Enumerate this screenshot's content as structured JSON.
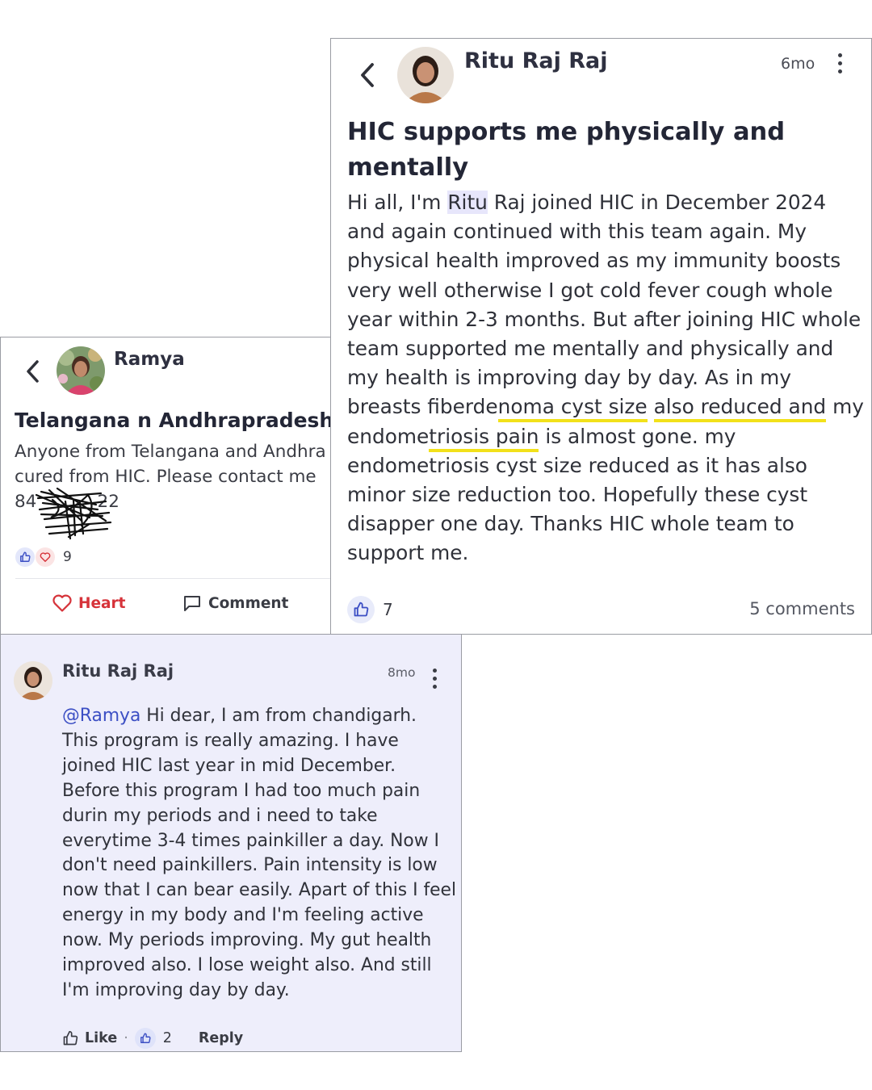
{
  "ramya_post": {
    "author": "Ramya",
    "title": "Telangana n Andhrapradesh",
    "body_lines": [
      "Anyone from Telangana and Andhra",
      "cured from HIC. Please contact me",
      "84           22"
    ],
    "reaction_count": "9",
    "heart_label": "Heart",
    "comment_label": "Comment"
  },
  "ritu_post": {
    "author": "Ritu Raj Raj",
    "time": "6mo",
    "title": "HIC supports me physically and mentally",
    "body": {
      "p1": "Hi all, I'm ",
      "highlight": "Ritu",
      "p2": " Raj joined HIC in December 2024 and again continued with this team again. My physical health improved as my immunity boosts very well otherwise I got cold fever cough whole year within 2-3 months. But after joining HIC whole team supported me mentally and physically and my health is improving day by day. As in my breasts fiberde",
      "u1": "noma cyst size",
      "u2": "also reduced and",
      "p3": " my endome",
      "u3": "triosis pain",
      "p4": " is almost gone. my endometriosis cyst size reduced as it has also minor size reduction too. Hopefully these cyst disapper one day. Thanks HIC whole team to support me."
    },
    "like_count": "7",
    "comments_label": "5 comments"
  },
  "comment": {
    "author": "Ritu Raj Raj",
    "time": "8mo",
    "mention": "@Ramya",
    "text": " Hi dear, I am from chandigarh. This program is really amazing. I have joined HIC last year in mid December. Before this program I had too much pain durin my periods and i need to take everytime 3-4 times painkiller a day. Now I don't need painkillers. Pain intensity is low now that I can bear easily. Apart of this I feel energy in my body and I'm feeling active now. My periods improving. My gut health improved also. I lose weight also. And still I'm improving day by day.",
    "like_label": "Like",
    "separator": "·",
    "like_count": "2",
    "reply_label": "Reply"
  },
  "icons": [
    "chevron-left-icon",
    "thumbs-up-icon",
    "heart-icon",
    "comment-icon",
    "more-vertical-icon"
  ],
  "colors": {
    "accent_blue": "#3c4fc4",
    "heart_red": "#d6333a",
    "underline_yellow": "#f2e11a",
    "highlight_lavender": "#e7e6fb",
    "comment_bg": "#eeeefb"
  }
}
